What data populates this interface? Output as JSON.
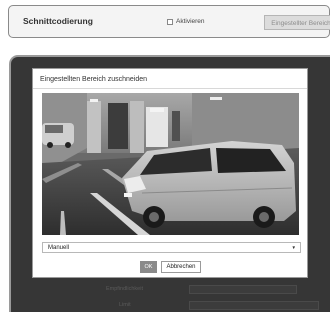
{
  "top_panel": {
    "title": "Schnittcodierung",
    "checkbox_label": "Aktivieren",
    "button_label": "Eingestellter Bereich"
  },
  "background": {
    "label_1": "Empfindlichkeit",
    "label_2": "Limit"
  },
  "dialog": {
    "title": "Eingestellten Bereich zuschneiden",
    "select_value": "Manuell",
    "ok_label": "OK",
    "cancel_label": "Abbrechen"
  }
}
